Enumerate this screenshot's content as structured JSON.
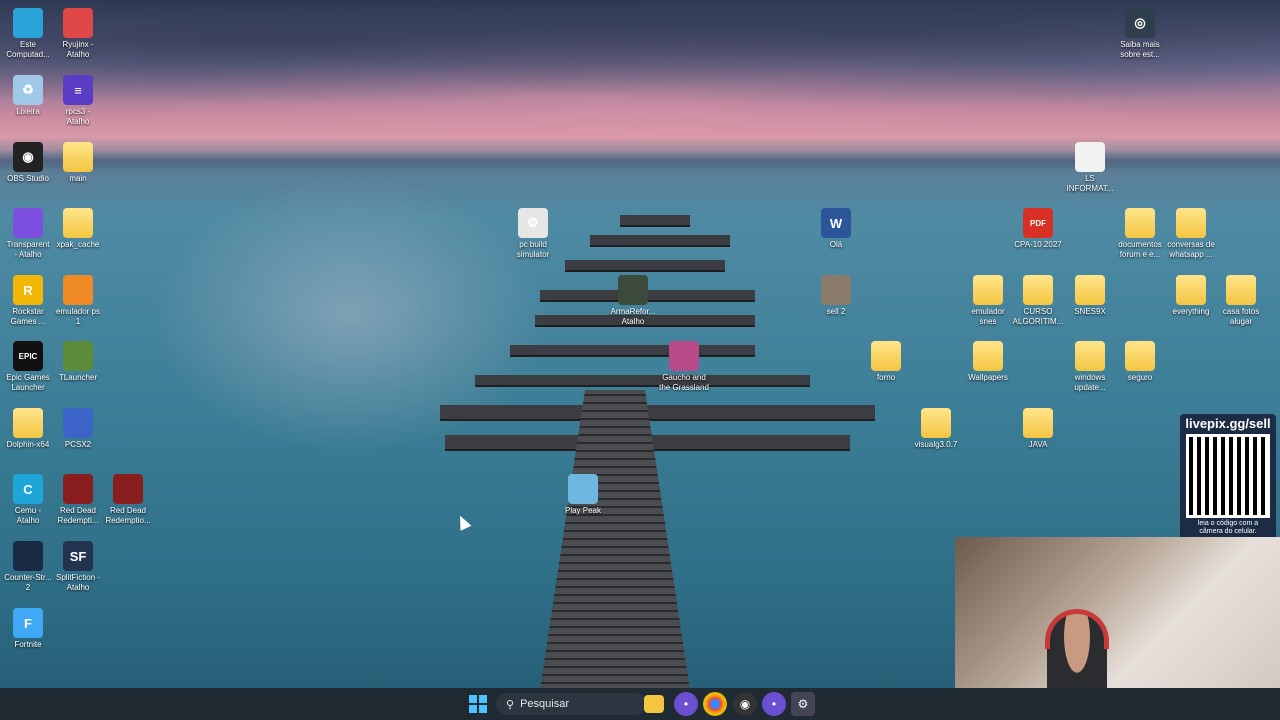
{
  "desktop": {
    "icons": [
      {
        "label": "Este\nComputad...",
        "icon": "computer-icon"
      },
      {
        "label": "Ryujinx -\nAtalho",
        "icon": "ryujinx-icon"
      },
      {
        "label": "Lixeira",
        "icon": "recycle-bin-icon"
      },
      {
        "label": "rpcs3 -\nAtalho",
        "icon": "rpcs3-icon"
      },
      {
        "label": "OBS Studio",
        "icon": "obs-icon"
      },
      {
        "label": "main",
        "icon": "folder-icon"
      },
      {
        "label": "Transparent\n- Atalho",
        "icon": "chat-icon"
      },
      {
        "label": "xpak_cache",
        "icon": "folder-icon"
      },
      {
        "label": "Rockstar\nGames ...",
        "icon": "rockstar-icon"
      },
      {
        "label": "emulador ps\n1",
        "icon": "emulator-icon"
      },
      {
        "label": "Epic Games\nLauncher",
        "icon": "epic-icon"
      },
      {
        "label": "TLauncher",
        "icon": "minecraft-icon"
      },
      {
        "label": "Dolphin-x64",
        "icon": "folder-icon"
      },
      {
        "label": "PCSX2",
        "icon": "pcsx2-icon"
      },
      {
        "label": "Cemu -\nAtalho",
        "icon": "cemu-icon"
      },
      {
        "label": "Red Dead\nRedempti...",
        "icon": "rdr-icon"
      },
      {
        "label": "Red Dead\nRedemptio...",
        "icon": "rdr-icon"
      },
      {
        "label": "Counter-Str...\n2",
        "icon": "cs2-icon"
      },
      {
        "label": "SplitFiction -\nAtalho",
        "icon": "splitfiction-icon"
      },
      {
        "label": "Fortnite",
        "icon": "fortnite-icon"
      },
      {
        "label": "pc build\nsimulator",
        "icon": "gear-icon"
      },
      {
        "label": "ArmaRefor...\nAtalho",
        "icon": "arma-icon"
      },
      {
        "label": "Gaucho and\nthe Grassland",
        "icon": "game-icon"
      },
      {
        "label": "Play Peak",
        "icon": "peak-icon"
      },
      {
        "label": "Olá",
        "icon": "word-icon"
      },
      {
        "label": "sell 2",
        "icon": "photo-icon"
      },
      {
        "label": "CPA-10 2027",
        "icon": "pdf-icon"
      },
      {
        "label": "documentos\nforum e e...",
        "icon": "folder-icon"
      },
      {
        "label": "conversas de\nwhatsapp ...",
        "icon": "folder-icon"
      },
      {
        "label": "LS\nINFORMAT...",
        "icon": "file-icon"
      },
      {
        "label": "emulador\nsnes",
        "icon": "folder-icon"
      },
      {
        "label": "CURSO\nALGORITIM...",
        "icon": "folder-icon"
      },
      {
        "label": "SNES9X",
        "icon": "folder-icon"
      },
      {
        "label": "everything",
        "icon": "folder-icon"
      },
      {
        "label": "casa fotos\nalugar",
        "icon": "folder-icon"
      },
      {
        "label": "forno",
        "icon": "folder-icon"
      },
      {
        "label": "Wallpapers",
        "icon": "folder-icon"
      },
      {
        "label": "windows\nupdate...",
        "icon": "folder-icon"
      },
      {
        "label": "seguro",
        "icon": "folder-icon"
      },
      {
        "label": "visualg3.0.7",
        "icon": "folder-icon"
      },
      {
        "label": "JAVA",
        "icon": "folder-icon"
      },
      {
        "label": "Saiba mais\nsobre est...",
        "icon": "camera-icon"
      }
    ]
  },
  "qr_overlay": {
    "title": "livepix.gg/sell",
    "subtitle": "leia o código com a\ncâmera do celular."
  },
  "taskbar": {
    "search_placeholder": "Pesquisar",
    "items": [
      "start-icon",
      "search-icon",
      "file-explorer-icon",
      "chat-app-icon",
      "chrome-icon",
      "obs-tray-icon",
      "chat-app-2-icon",
      "pc-build-icon"
    ]
  }
}
